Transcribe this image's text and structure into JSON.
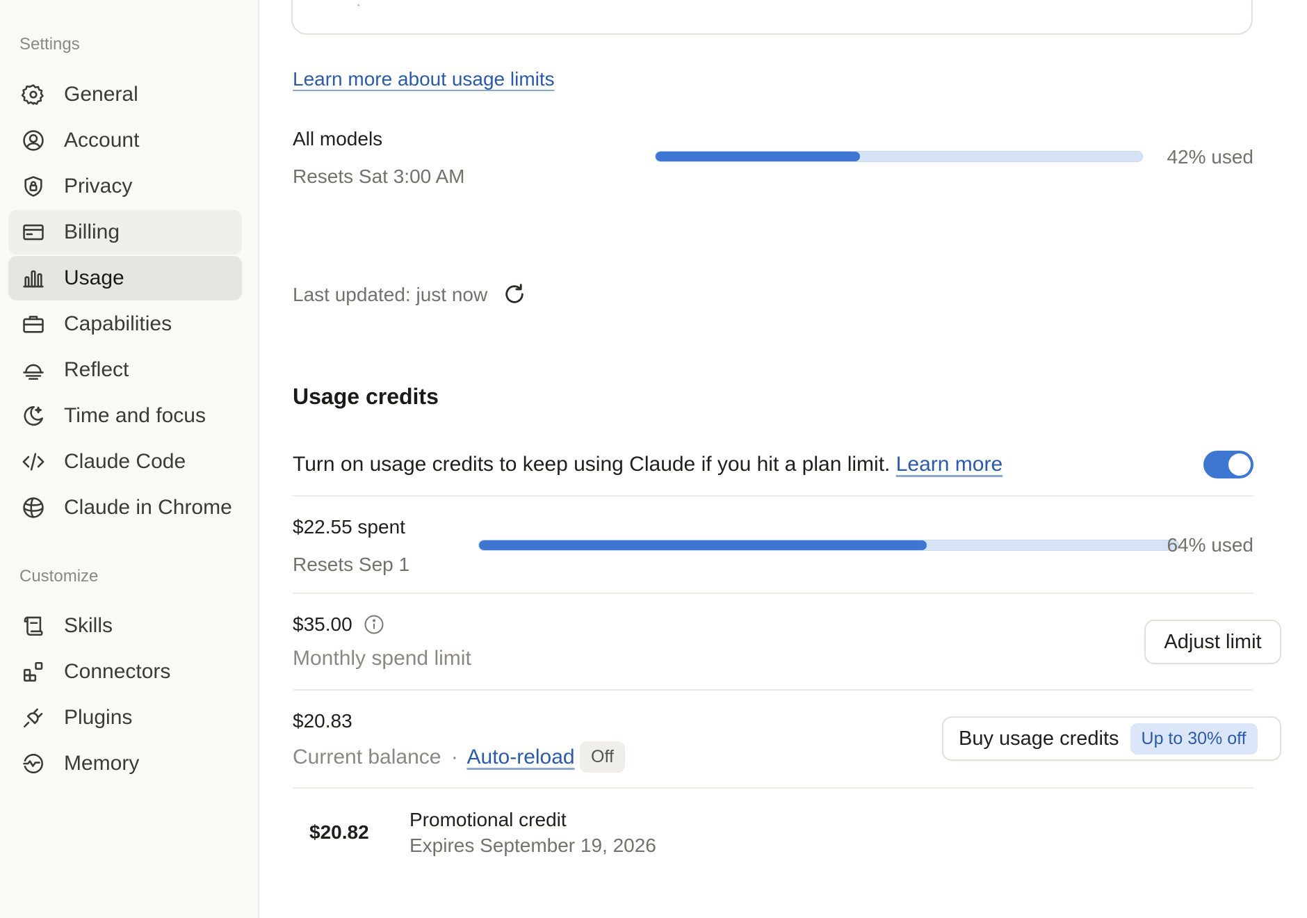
{
  "sidebar": {
    "settings_label": "Settings",
    "customize_label": "Customize",
    "items": [
      {
        "label": "General",
        "icon": "gear-icon"
      },
      {
        "label": "Account",
        "icon": "user-circle-icon"
      },
      {
        "label": "Privacy",
        "icon": "shield-lock-icon"
      },
      {
        "label": "Billing",
        "icon": "credit-card-icon"
      },
      {
        "label": "Usage",
        "icon": "bar-chart-icon"
      },
      {
        "label": "Capabilities",
        "icon": "briefcase-icon"
      },
      {
        "label": "Reflect",
        "icon": "sunrise-icon"
      },
      {
        "label": "Time and focus",
        "icon": "moon-icon"
      },
      {
        "label": "Claude Code",
        "icon": "code-icon"
      },
      {
        "label": "Claude in Chrome",
        "icon": "globe-icon"
      }
    ],
    "customize_items": [
      {
        "label": "Skills",
        "icon": "scroll-icon"
      },
      {
        "label": "Connectors",
        "icon": "blocks-icon"
      },
      {
        "label": "Plugins",
        "icon": "plug-icon"
      },
      {
        "label": "Memory",
        "icon": "memory-icon"
      }
    ],
    "active_item": "Usage"
  },
  "main": {
    "learn_more_limits": "Learn more about usage limits",
    "all_models": {
      "title": "All models",
      "reset": "Resets Sat 3:00 AM",
      "percent_used": 42,
      "used_text": "42% used"
    },
    "last_updated": "Last updated: just now",
    "usage_credits": {
      "heading": "Usage credits",
      "description": "Turn on usage credits to keep using Claude if you hit a plan limit.",
      "learn_more": "Learn more",
      "enabled": true,
      "spent": {
        "amount": "$22.55 spent",
        "reset": "Resets Sep 1",
        "percent_used": 64,
        "used_text": "64% used"
      },
      "limit": {
        "amount": "$35.00",
        "label": "Monthly spend limit",
        "button": "Adjust limit"
      },
      "balance": {
        "amount": "$20.83",
        "label": "Current balance",
        "separator": "·",
        "auto_reload": "Auto-reload",
        "auto_reload_state": "Off",
        "buy_button": "Buy usage credits",
        "discount_badge": "Up to 30% off"
      },
      "promo": {
        "amount": "$20.82",
        "title": "Promotional credit",
        "expires": "Expires September 19, 2026"
      }
    }
  },
  "colors": {
    "accent": "#3e76d2",
    "link": "#2b5ba8",
    "bar_track": "#d6e3f7",
    "sidebar_bg": "#faf9f6",
    "active_bg": "#e7e5df"
  }
}
